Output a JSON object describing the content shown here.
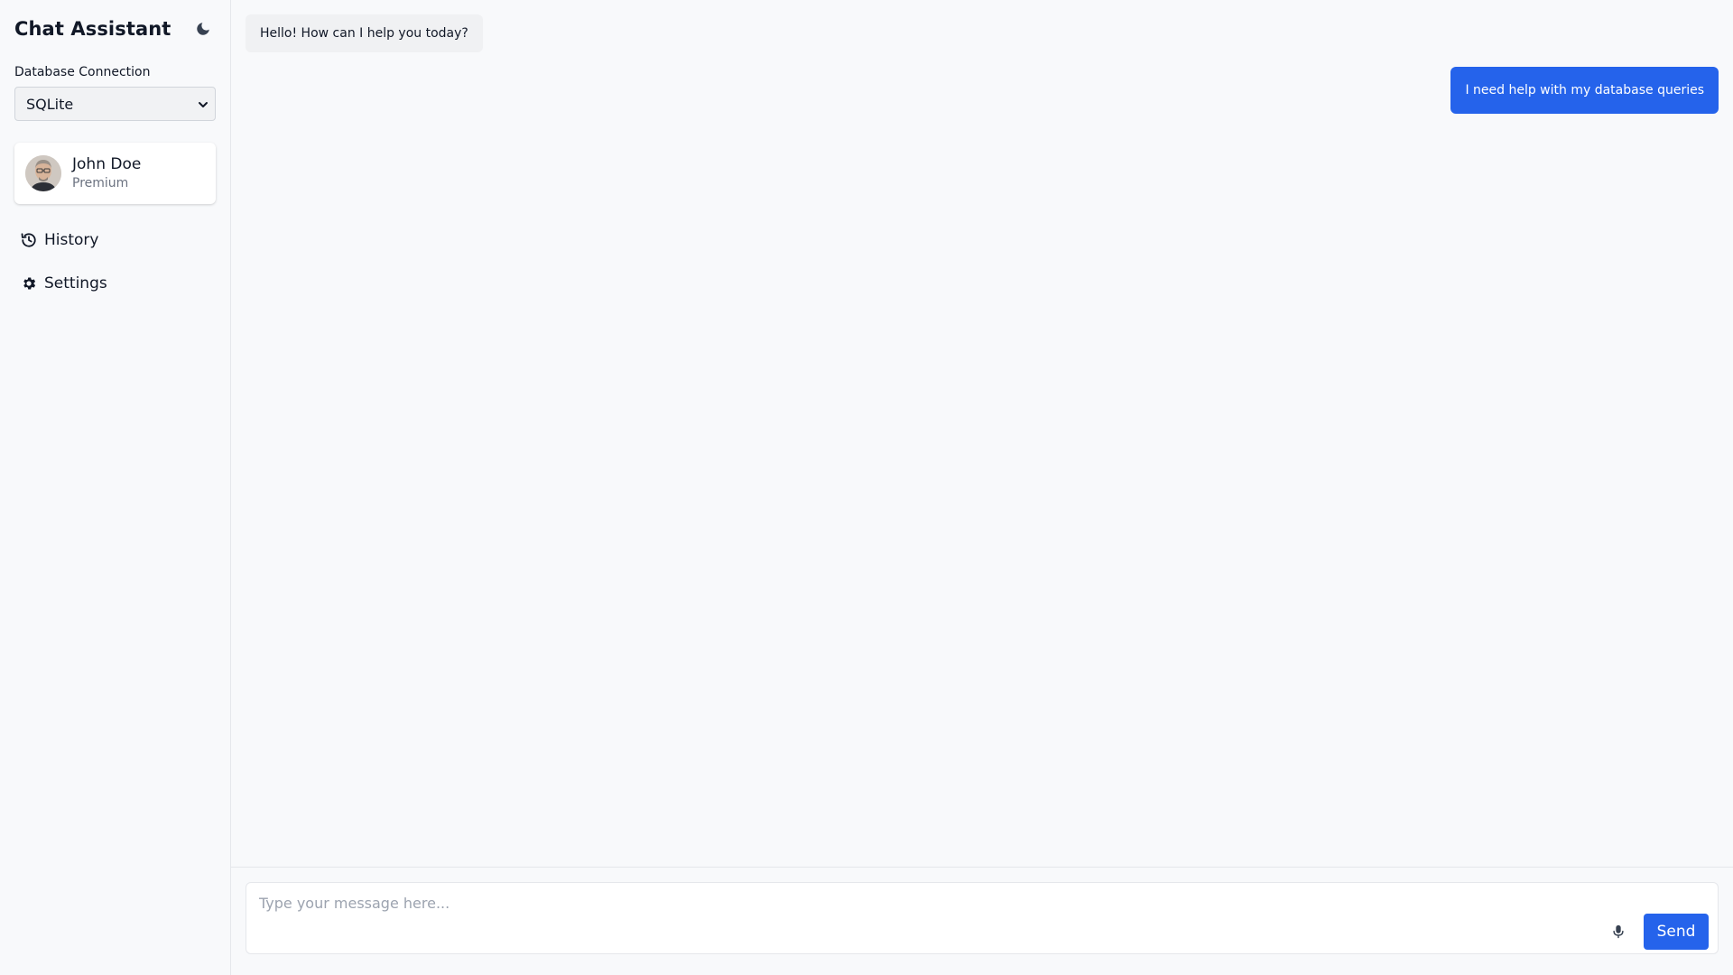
{
  "app": {
    "title": "Chat Assistant",
    "theme_icon": "moon-icon"
  },
  "sidebar": {
    "db_connection_label": "Database Connection",
    "db_selected": "SQLite",
    "user": {
      "name": "John Doe",
      "plan": "Premium",
      "avatar_icon": "avatar-photo"
    },
    "nav": [
      {
        "label": "History",
        "icon": "history-icon"
      },
      {
        "label": "Settings",
        "icon": "gear-icon"
      }
    ]
  },
  "messages": [
    {
      "role": "assistant",
      "text": "Hello! How can I help you today?"
    },
    {
      "role": "user",
      "text": "I need help with my database queries"
    }
  ],
  "composer": {
    "placeholder": "Type your message here...",
    "value": "",
    "send_label": "Send",
    "mic_icon": "microphone-icon"
  },
  "colors": {
    "accent": "#2563eb",
    "background": "#f8f9fb",
    "assistant_bubble": "#f0f1f3"
  }
}
